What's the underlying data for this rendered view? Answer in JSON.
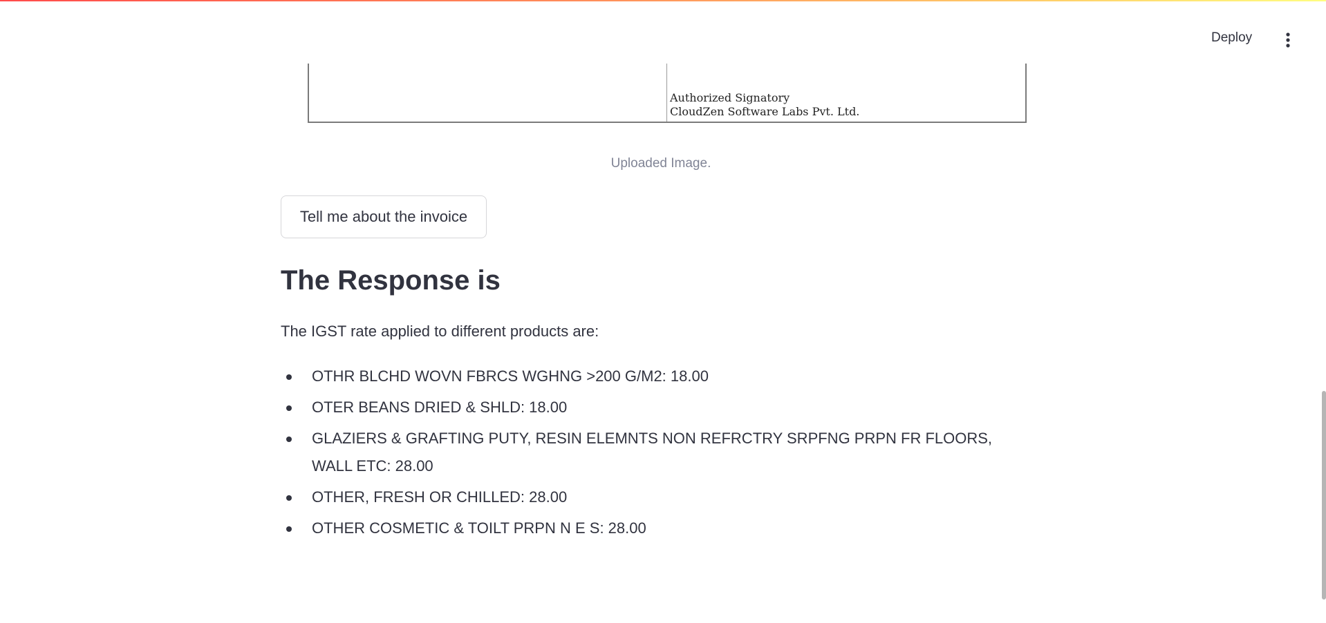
{
  "header": {
    "deploy_label": "Deploy",
    "menu_icon": "vertical-ellipsis-icon"
  },
  "image": {
    "signatory_line1": "Authorized Signatory",
    "signatory_line2": "CloudZen Software Labs Pvt. Ltd.",
    "caption": "Uploaded Image."
  },
  "prompt_button": {
    "label": "Tell me about the invoice"
  },
  "response": {
    "heading": "The Response is",
    "intro": "The IGST rate applied to different products are:",
    "items": [
      "OTHR BLCHD WOVN FBRCS WGHNG >200 G/M2: 18.00",
      "OTER BEANS DRIED & SHLD: 18.00",
      "GLAZIERS & GRAFTING PUTY, RESIN ELEMNTS NON REFRCTRY SRPFNG PRPN FR FLOORS, WALL ETC: 28.00",
      "OTHER, FRESH OR CHILLED: 28.00",
      "OTHER COSMETIC & TOILT PRPN N E S: 28.00"
    ]
  },
  "colors": {
    "text": "#31333f",
    "caption": "#808495",
    "accent_gradient_start": "#ff4b4b",
    "accent_gradient_end": "#fffd80"
  }
}
